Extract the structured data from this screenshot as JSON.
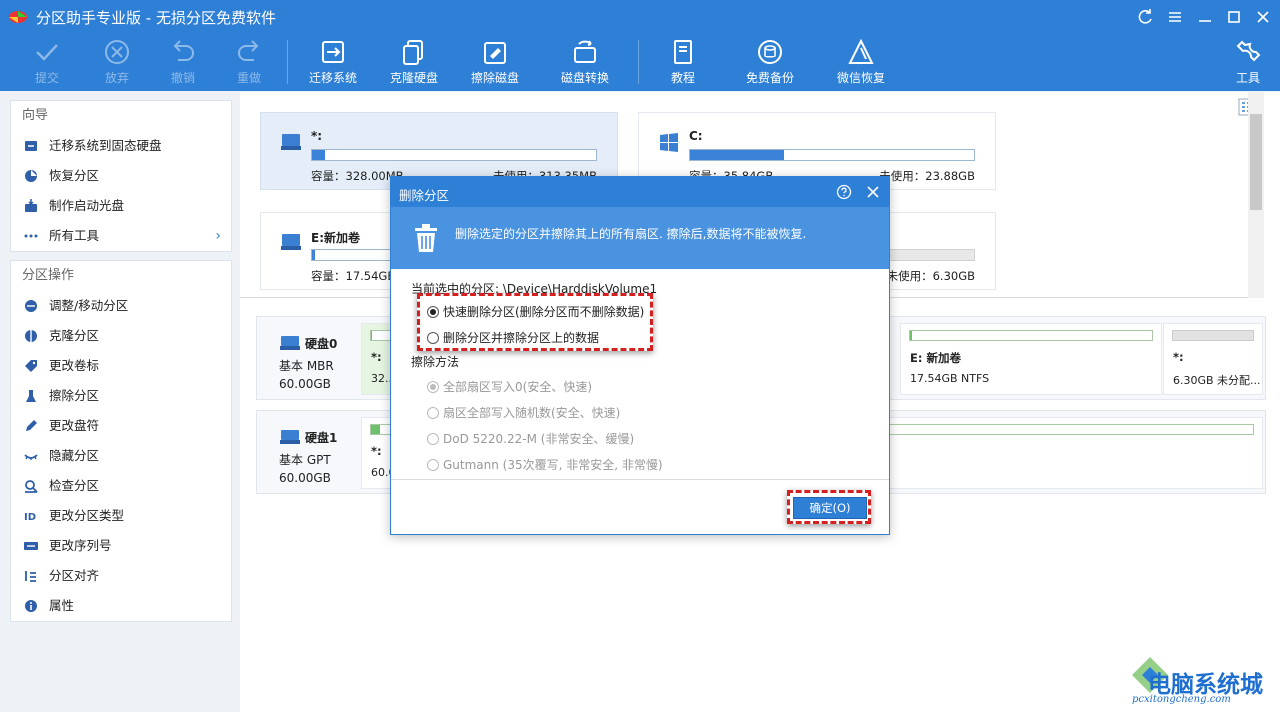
{
  "app": {
    "title": "分区助手专业版 - 无损分区免费软件"
  },
  "toolbar": {
    "submit": "提交",
    "discard": "放弃",
    "undo": "撤销",
    "redo": "重做",
    "migrate": "迁移系统",
    "clone": "克隆硬盘",
    "wipe": "擦除磁盘",
    "convert": "磁盘转换",
    "tutorial": "教程",
    "backup": "免费备份",
    "wechat": "微信恢复",
    "tools": "工具"
  },
  "sidebar": {
    "wizard_header": "向导",
    "wizard_items": [
      {
        "label": "迁移系统到固态硬盘",
        "icon": "migrate-icon"
      },
      {
        "label": "恢复分区",
        "icon": "recover-icon"
      },
      {
        "label": "制作启动光盘",
        "icon": "bootable-icon"
      },
      {
        "label": "所有工具",
        "icon": "more-icon"
      }
    ],
    "ops_header": "分区操作",
    "ops_items": [
      {
        "label": "调整/移动分区",
        "icon": "resize-icon"
      },
      {
        "label": "克隆分区",
        "icon": "clone-icon"
      },
      {
        "label": "更改卷标",
        "icon": "tag-icon"
      },
      {
        "label": "擦除分区",
        "icon": "wipe-icon"
      },
      {
        "label": "更改盘符",
        "icon": "pencil-icon"
      },
      {
        "label": "隐藏分区",
        "icon": "hide-icon"
      },
      {
        "label": "检查分区",
        "icon": "check-icon"
      },
      {
        "label": "更改分区类型",
        "icon": "id-icon"
      },
      {
        "label": "更改序列号",
        "icon": "serial-icon"
      },
      {
        "label": "分区对齐",
        "icon": "align-icon"
      },
      {
        "label": "属性",
        "icon": "info-icon"
      }
    ]
  },
  "partitions": [
    {
      "name": "*:",
      "capacity": "容量：328.00MB",
      "unused": "未使用：313.35MB",
      "used_fraction": 0.045,
      "selected": true
    },
    {
      "name": "C:",
      "capacity": "容量：35.84GB",
      "unused": "未使用：23.88GB",
      "used_fraction": 0.33,
      "selected": false
    },
    {
      "name": "E:新加卷",
      "capacity": "容量：17.54GB",
      "unused": "",
      "used_fraction": 0.01,
      "selected": false
    },
    {
      "name": "",
      "capacity": "",
      "unused": "未使用：6.30GB",
      "used_fraction": 0.0,
      "selected": false
    }
  ],
  "disks": [
    {
      "name": "硬盘0",
      "type": "基本 MBR",
      "size": "60.00GB",
      "segments": [
        {
          "label": "*:",
          "size": "32...",
          "fill": 0.045
        },
        {
          "label": "E: 新加卷",
          "size": "17.54GB NTFS",
          "fill": 0.01
        },
        {
          "label": "*:",
          "size": "6.30GB 未分配...",
          "fill": 0.0
        }
      ]
    },
    {
      "name": "硬盘1",
      "type": "基本 GPT",
      "size": "60.00GB",
      "segments": [
        {
          "label": "*:",
          "size": "60.0",
          "fill": 0.01
        }
      ]
    }
  ],
  "dialog": {
    "title": "删除分区",
    "banner": "删除选定的分区并擦除其上的所有扇区. 擦除后,数据将不能被恢复.",
    "current_label": "当前选中的分区: \\Device\\HarddiskVolume1",
    "option_quick": "快速删除分区(删除分区而不删除数据)",
    "option_wipe": "删除分区并擦除分区上的数据",
    "wipe_method_title": "擦除方法",
    "methods": [
      "全部扇区写入0(安全、快速)",
      "扇区全部写入随机数(安全、快速)",
      "DoD 5220.22-M (非常安全、缓慢)",
      "Gutmann (35次覆写, 非常安全, 非常慢)"
    ],
    "ok": "确定(O)"
  },
  "watermark": {
    "text": "电脑系统城",
    "url": "pcxitongcheng.com"
  },
  "colors": {
    "accent": "#2e7fd6",
    "highlight": "#d62020",
    "partition_used": "#3a83d8",
    "disk_used": "#6cc16a"
  }
}
